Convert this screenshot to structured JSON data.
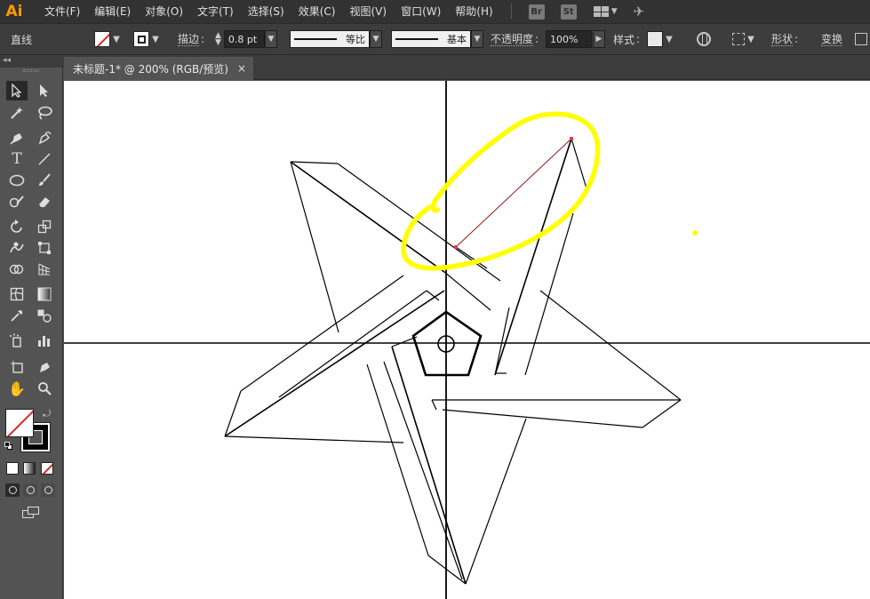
{
  "app": {
    "logo": "Ai"
  },
  "menu": {
    "items": [
      "文件(F)",
      "编辑(E)",
      "对象(O)",
      "文字(T)",
      "选择(S)",
      "效果(C)",
      "视图(V)",
      "窗口(W)",
      "帮助(H)"
    ],
    "bridge_badge": "Br",
    "stock_badge": "St"
  },
  "control_bar": {
    "object_type": "直线",
    "stroke_label": "描边",
    "stroke_weight": "0.8 pt",
    "profile_label": "等比",
    "brush_label": "基本",
    "opacity_label": "不透明度",
    "opacity_value": "100%",
    "style_label": "样式",
    "shape_label": "形状",
    "transform_label": "变换"
  },
  "document": {
    "tab_title": "未标题-1* @ 200% (RGB/预览)",
    "close_glyph": "×"
  },
  "tools": {
    "panel_collapse": "◂◂",
    "items": [
      "selection",
      "direct-selection",
      "magic-wand",
      "lasso",
      "pen",
      "curvature",
      "type",
      "line-segment",
      "ellipse",
      "paintbrush",
      "shaper",
      "eraser",
      "rotate",
      "scale",
      "warp",
      "free-transform",
      "shape-builder",
      "perspective-grid",
      "mesh",
      "gradient",
      "eyedropper",
      "blend",
      "symbol-sprayer",
      "column-graph",
      "artboard",
      "slice",
      "hand",
      "zoom"
    ]
  },
  "colors": {
    "accent_logo": "#ff9a00",
    "highlight": "#ffff00",
    "anchor_point": "#e8384f",
    "selected_path": "#8b1a1a",
    "none_slash": "#d8262c"
  }
}
